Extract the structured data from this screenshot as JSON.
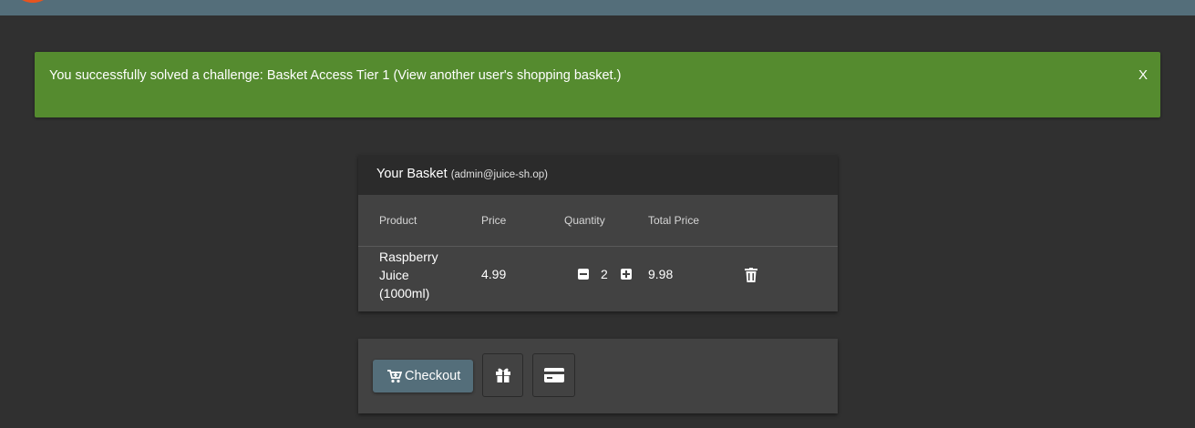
{
  "notification": {
    "message": "You successfully solved a challenge: Basket Access Tier 1 (View another user's shopping basket.)",
    "close_label": "X",
    "color": "#558b2f"
  },
  "basket": {
    "title": "Your Basket",
    "user": "(admin@juice-sh.op)",
    "columns": [
      "Product",
      "Price",
      "Quantity",
      "Total Price"
    ],
    "items": [
      {
        "product": "Raspberry Juice (1000ml)",
        "price": "4.99",
        "quantity": "2",
        "total": "9.98"
      }
    ]
  },
  "actions": {
    "checkout_label": "Checkout",
    "checkout_icon": "cart-icon",
    "gift_icon": "gift-icon",
    "card_icon": "credit-card-icon"
  },
  "theme": {
    "accent": "#546e7a",
    "background": "#303030",
    "card": "#424242"
  }
}
